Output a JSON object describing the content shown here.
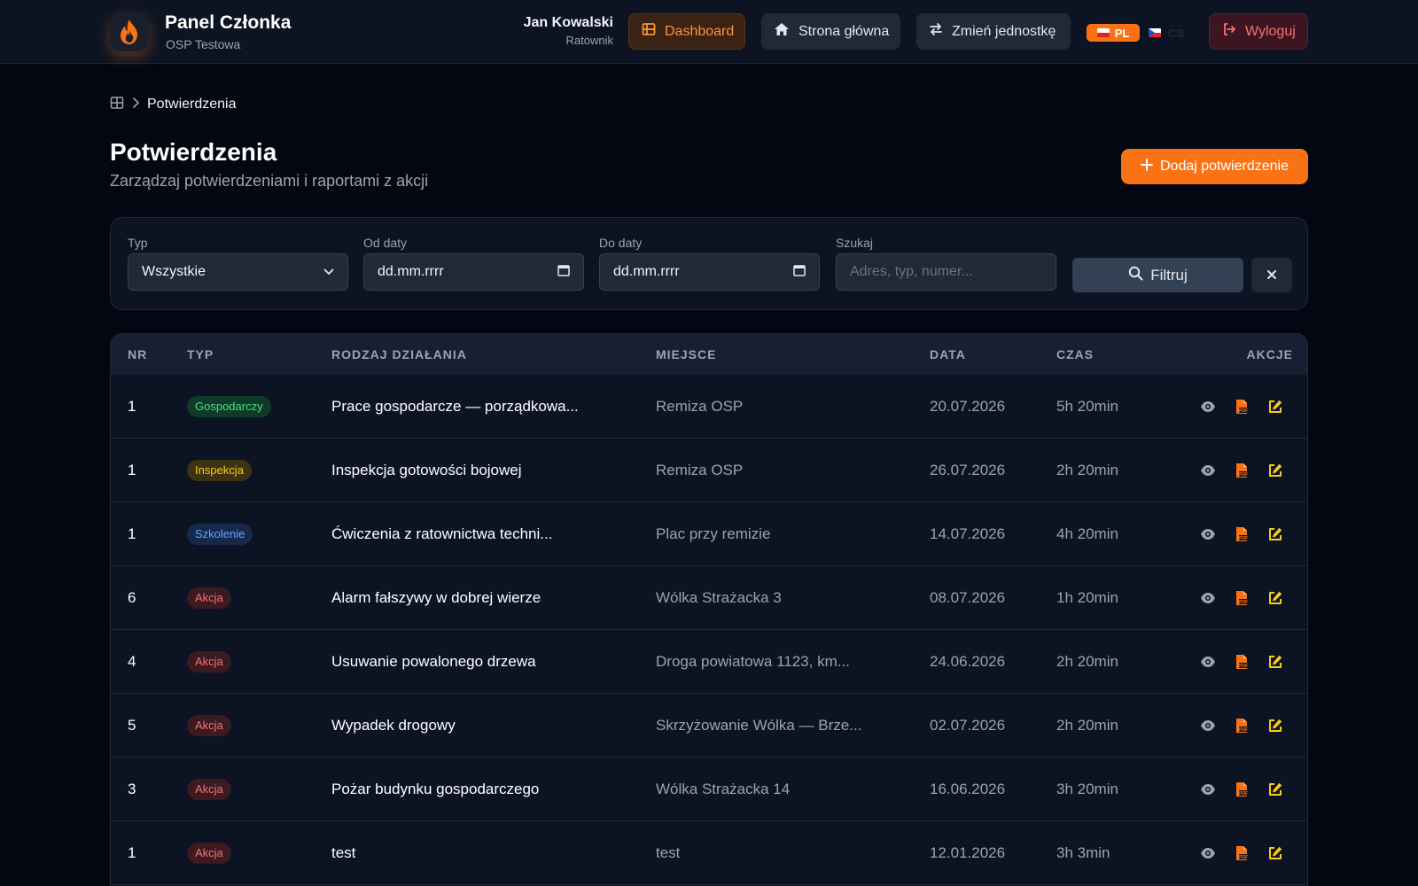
{
  "header": {
    "brand_title": "Panel Członka",
    "brand_subtitle": "OSP Testowa",
    "user_name": "Jan Kowalski",
    "user_role": "Ratownik",
    "nav": {
      "dashboard": "Dashboard",
      "home": "Strona główna",
      "switch_unit": "Zmień jednostkę",
      "logout": "Wyloguj"
    },
    "languages": {
      "active": "PL",
      "other": "CS"
    }
  },
  "breadcrumb": {
    "current": "Potwierdzenia"
  },
  "page": {
    "title": "Potwierdzenia",
    "subtitle": "Zarządzaj potwierdzeniami i raportami z akcji",
    "add_button": "Dodaj potwierdzenie"
  },
  "filters": {
    "type_label": "Typ",
    "type_value": "Wszystkie",
    "from_label": "Od daty",
    "from_value": "dd.mm.rrrr",
    "to_label": "Do daty",
    "to_value": "dd.mm.rrrr",
    "search_label": "Szukaj",
    "search_placeholder": "Adres, typ, numer...",
    "filter_button": "Filtruj"
  },
  "table": {
    "headers": {
      "nr": "NR",
      "typ": "TYP",
      "rodzaj": "RODZAJ DZIAŁANIA",
      "miejsce": "MIEJSCE",
      "data": "DATA",
      "czas": "CZAS",
      "akcje": "AKCJE"
    },
    "rows": [
      {
        "nr": "1",
        "typ": "Gospodarczy",
        "rodzaj": "Prace gospodarcze — porządkowa...",
        "miejsce": "Remiza OSP",
        "data": "20.07.2026",
        "czas": "5h 20min"
      },
      {
        "nr": "1",
        "typ": "Inspekcja",
        "rodzaj": "Inspekcja gotowości bojowej",
        "miejsce": "Remiza OSP",
        "data": "26.07.2026",
        "czas": "2h 20min"
      },
      {
        "nr": "1",
        "typ": "Szkolenie",
        "rodzaj": "Ćwiczenia z ratownictwa techni...",
        "miejsce": "Plac przy remizie",
        "data": "14.07.2026",
        "czas": "4h 20min"
      },
      {
        "nr": "6",
        "typ": "Akcja",
        "rodzaj": "Alarm fałszywy w dobrej wierze",
        "miejsce": "Wólka Strażacka 3",
        "data": "08.07.2026",
        "czas": "1h 20min"
      },
      {
        "nr": "4",
        "typ": "Akcja",
        "rodzaj": "Usuwanie powalonego drzewa",
        "miejsce": "Droga powiatowa 1123, km...",
        "data": "24.06.2026",
        "czas": "2h 20min"
      },
      {
        "nr": "5",
        "typ": "Akcja",
        "rodzaj": "Wypadek drogowy",
        "miejsce": "Skrzyżowanie Wólka — Brze...",
        "data": "02.07.2026",
        "czas": "2h 20min"
      },
      {
        "nr": "3",
        "typ": "Akcja",
        "rodzaj": "Pożar budynku gospodarczego",
        "miejsce": "Wólka Strażacka 14",
        "data": "16.06.2026",
        "czas": "3h 20min"
      },
      {
        "nr": "1",
        "typ": "Akcja",
        "rodzaj": "test",
        "miejsce": "test",
        "data": "12.01.2026",
        "czas": "3h 3min"
      }
    ]
  },
  "badge_colors": {
    "Gospodarczy": {
      "bg": "#0f3a2a",
      "fg": "#4ade80"
    },
    "Inspekcja": {
      "bg": "#3d3312",
      "fg": "#facc15"
    },
    "Szkolenie": {
      "bg": "#16294d",
      "fg": "#60a5fa"
    },
    "Akcja": {
      "bg": "#3b1a20",
      "fg": "#f87171"
    }
  },
  "colors": {
    "accent": "#f97316",
    "background": "#030712",
    "panel": "#0c1423"
  }
}
